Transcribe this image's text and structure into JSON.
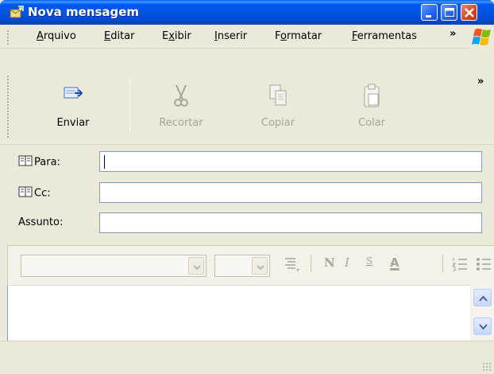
{
  "window": {
    "title": "Nova mensagem",
    "accent_color": "#0054E3",
    "close_color": "#D6461E"
  },
  "menu": {
    "items": [
      {
        "label": "Arquivo",
        "accel": "A"
      },
      {
        "label": "Editar",
        "accel": "E"
      },
      {
        "label": "Exibir",
        "accel": "x"
      },
      {
        "label": "Inserir",
        "accel": "I"
      },
      {
        "label": "Formatar",
        "accel": "o"
      },
      {
        "label": "Ferramentas",
        "accel": "F"
      }
    ],
    "overflow": "»"
  },
  "toolbar": {
    "send_label": "Enviar",
    "cut_label": "Recortar",
    "copy_label": "Copiar",
    "paste_label": "Colar",
    "overflow": "»"
  },
  "fields": {
    "to_label": "Para:",
    "to_value": "",
    "cc_label": "Cc:",
    "cc_value": "",
    "subject_label": "Assunto:",
    "subject_value": ""
  },
  "format_bar": {
    "font_value": "",
    "size_value": "",
    "bold": "N",
    "italic": "I",
    "underline": "S",
    "font_color": "A"
  },
  "icons": {
    "send": "send-icon",
    "cut": "scissors-icon",
    "copy": "copy-icon",
    "paste": "paste-icon",
    "address_book": "address-book-icon"
  }
}
